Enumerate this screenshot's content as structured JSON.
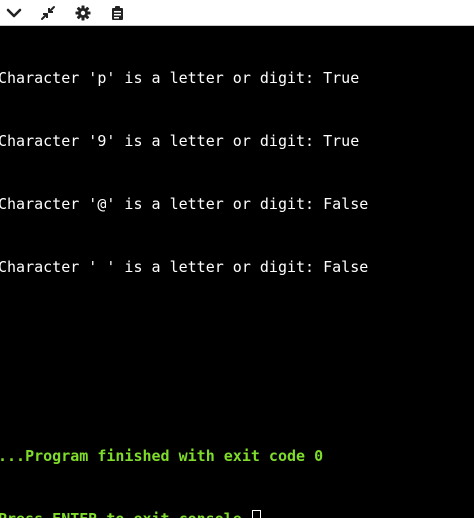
{
  "toolbar": {
    "buttons": [
      "chevron-down-icon",
      "collapse-icon",
      "gear-icon",
      "clipboard-icon"
    ]
  },
  "console": {
    "output_lines": [
      "Character 'p' is a letter or digit: True",
      "Character '9' is a letter or digit: True",
      "Character '@' is a letter or digit: False",
      "Character ' ' is a letter or digit: False"
    ],
    "finish_message": "...Program finished with exit code 0",
    "prompt_message": "Press ENTER to exit console."
  },
  "colors": {
    "background": "#000000",
    "output_text": "#ffffff",
    "status_text": "#7fdc2a",
    "toolbar": "#ffffff"
  }
}
